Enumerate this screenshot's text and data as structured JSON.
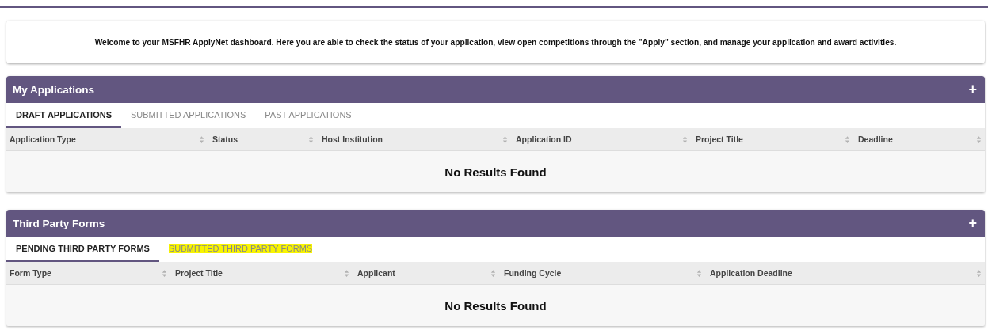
{
  "welcome": "Welcome to your MSFHR ApplyNet dashboard. Here you are able to check the status of your application, view open competitions through the \"Apply\" section, and manage your application and award activities.",
  "panels": [
    {
      "title": "My Applications",
      "expand_symbol": "+",
      "tabs": [
        {
          "label": "DRAFT APPLICATIONS",
          "selected": true,
          "highlighted": false
        },
        {
          "label": "SUBMITTED APPLICATIONS",
          "selected": false,
          "highlighted": false
        },
        {
          "label": "PAST APPLICATIONS",
          "selected": false,
          "highlighted": false
        }
      ],
      "columns": [
        "Application Type",
        "Status",
        "Host Institution",
        "Application ID",
        "Project Title",
        "Deadline"
      ],
      "empty_message": "No Results Found"
    },
    {
      "title": "Third Party Forms",
      "expand_symbol": "+",
      "tabs": [
        {
          "label": "PENDING THIRD PARTY FORMS",
          "selected": true,
          "highlighted": false
        },
        {
          "label": "SUBMITTED THIRD PARTY FORMS",
          "selected": false,
          "highlighted": true
        }
      ],
      "columns": [
        "Form Type",
        "Project Title",
        "Applicant",
        "Funding Cycle",
        "Application Deadline"
      ],
      "empty_message": "No Results Found"
    }
  ]
}
